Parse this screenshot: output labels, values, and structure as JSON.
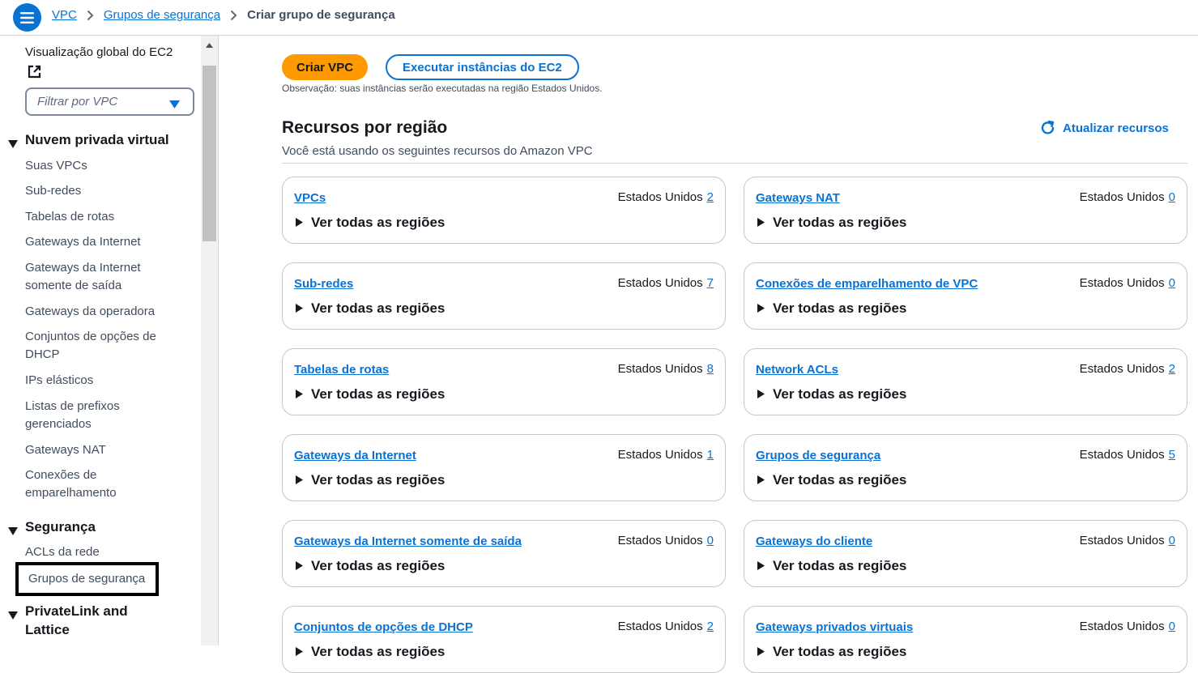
{
  "breadcrumb": {
    "items": [
      "VPC",
      "Grupos de segurança"
    ],
    "current": "Criar grupo de segurança"
  },
  "sidebar": {
    "global_view": "Visualização global do EC2",
    "filter_placeholder": "Filtrar por VPC",
    "sections": [
      {
        "title": "Nuvem privada virtual",
        "items": [
          "Suas VPCs",
          "Sub-redes",
          "Tabelas de rotas",
          "Gateways da Internet",
          "Gateways da Internet somente de saída",
          "Gateways da operadora",
          "Conjuntos de opções de DHCP",
          "IPs elásticos",
          "Listas de prefixos gerenciados",
          "Gateways NAT",
          "Conexões de emparelhamento"
        ]
      },
      {
        "title": "Segurança",
        "items": [
          "ACLs da rede",
          "Grupos de segurança"
        ]
      },
      {
        "title": "PrivateLink and Lattice",
        "items": []
      }
    ]
  },
  "main": {
    "create_vpc_label": "Criar VPC",
    "launch_ec2_label": "Executar instâncias do EC2",
    "note": "Observação: suas instâncias serão executadas na região Estados Unidos.",
    "section_title": "Recursos por região",
    "section_subtitle": "Você está usando os seguintes recursos do Amazon VPC",
    "refresh_label": "Atualizar recursos",
    "expand_label": "Ver todas as regiões",
    "region_label": "Estados Unidos",
    "cards": [
      {
        "name": "VPCs",
        "count": "2"
      },
      {
        "name": "Gateways NAT",
        "count": "0"
      },
      {
        "name": "Sub-redes",
        "count": "7"
      },
      {
        "name": "Conexões de emparelhamento de VPC",
        "count": "0"
      },
      {
        "name": "Tabelas de rotas",
        "count": "8"
      },
      {
        "name": "Network ACLs",
        "count": "2"
      },
      {
        "name": "Gateways da Internet",
        "count": "1"
      },
      {
        "name": "Grupos de segurança",
        "count": "5"
      },
      {
        "name": "Gateways da Internet somente de saída",
        "count": "0"
      },
      {
        "name": "Gateways do cliente",
        "count": "0"
      },
      {
        "name": "Conjuntos de opções de DHCP",
        "count": "2"
      },
      {
        "name": "Gateways privados virtuais",
        "count": "0"
      }
    ]
  },
  "colors": {
    "link": "#0972d3",
    "primary_button": "#ff9900",
    "text": "#16191f"
  },
  "icons": [
    "menu-icon",
    "chevron-right-icon",
    "external-link-icon",
    "caret-down-icon",
    "triangle-down-icon",
    "triangle-right-icon",
    "refresh-icon",
    "scroll-up-icon"
  ]
}
